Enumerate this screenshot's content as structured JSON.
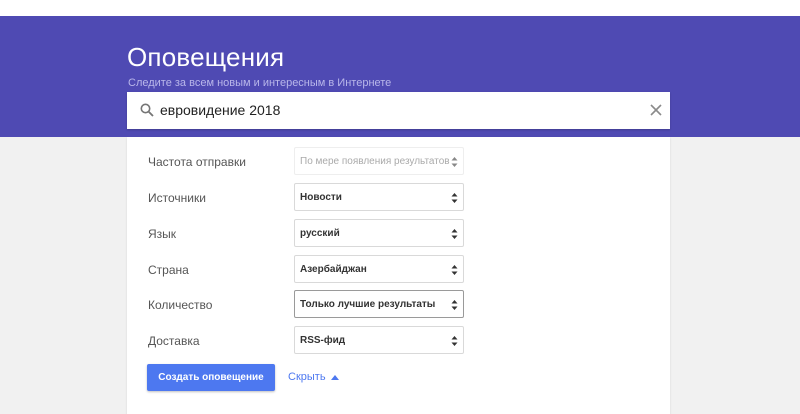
{
  "header": {
    "title": "Оповещения",
    "subtitle": "Следите за всем новым и интересным в Интернете"
  },
  "search": {
    "value": "евровидение 2018",
    "search_icon": "search-icon",
    "clear_icon": "close-icon"
  },
  "options": [
    {
      "label": "Частота отправки",
      "value": "По мере появления результатов",
      "state": "disabled"
    },
    {
      "label": "Источники",
      "value": "Новости",
      "state": "normal"
    },
    {
      "label": "Язык",
      "value": "русский",
      "state": "normal"
    },
    {
      "label": "Страна",
      "value": "Азербайджан",
      "state": "normal"
    },
    {
      "label": "Количество",
      "value": "Только лучшие результаты",
      "state": "focused"
    },
    {
      "label": "Доставка",
      "value": "RSS-фид",
      "state": "normal"
    }
  ],
  "actions": {
    "create_label": "Создать оповещение",
    "hide_label": "Скрыть",
    "hide_icon": "chevron-up-icon"
  },
  "colors": {
    "header_bg": "#4f4ab3",
    "accent": "#4d78f0",
    "page_bg": "#f1f1f1"
  }
}
